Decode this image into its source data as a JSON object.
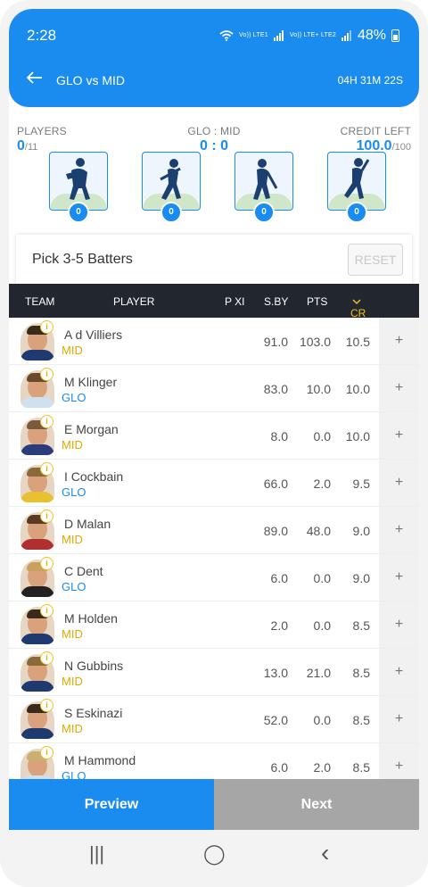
{
  "status_bar": {
    "time": "2:28",
    "signal_1": "Vo)) LTE1",
    "signal_2": "Vo)) LTE+ LTE2",
    "battery": "48%"
  },
  "header": {
    "back_icon": "arrow-left-icon",
    "title": "GLO vs MID",
    "timer": "04H 31M 22S"
  },
  "summary": {
    "players_label": "PLAYERS",
    "players_count": "0",
    "players_total": "/11",
    "match_label": "GLO : MID",
    "match_score": "0 : 0",
    "credit_label": "CREDIT LEFT",
    "credit_value": "100.0",
    "credit_total": "/100"
  },
  "roles": [
    {
      "icon": "wicket-keeper-icon",
      "count": "0"
    },
    {
      "icon": "batter-icon",
      "count": "0"
    },
    {
      "icon": "all-rounder-icon",
      "count": "0"
    },
    {
      "icon": "bowler-icon",
      "count": "0"
    }
  ],
  "pick": {
    "text": "Pick 3-5 Batters",
    "reset": "RESET"
  },
  "table": {
    "headers": {
      "team": "TEAM",
      "player": "PLAYER",
      "pxi": "P XI",
      "sby": "S.BY",
      "pts": "PTS",
      "cr": "CR"
    },
    "rows": [
      {
        "name": "A d Villiers",
        "team": "MID",
        "sby": "91.0",
        "pts": "103.0",
        "cr": "10.5"
      },
      {
        "name": "M Klinger",
        "team": "GLO",
        "sby": "83.0",
        "pts": "10.0",
        "cr": "10.0"
      },
      {
        "name": "E Morgan",
        "team": "MID",
        "sby": "8.0",
        "pts": "0.0",
        "cr": "10.0"
      },
      {
        "name": "I Cockbain",
        "team": "GLO",
        "sby": "66.0",
        "pts": "2.0",
        "cr": "9.5"
      },
      {
        "name": "D Malan",
        "team": "MID",
        "sby": "89.0",
        "pts": "48.0",
        "cr": "9.0"
      },
      {
        "name": "C Dent",
        "team": "GLO",
        "sby": "6.0",
        "pts": "0.0",
        "cr": "9.0"
      },
      {
        "name": "M Holden",
        "team": "MID",
        "sby": "2.0",
        "pts": "0.0",
        "cr": "8.5"
      },
      {
        "name": "N Gubbins",
        "team": "MID",
        "sby": "13.0",
        "pts": "21.0",
        "cr": "8.5"
      },
      {
        "name": "S Eskinazi",
        "team": "MID",
        "sby": "52.0",
        "pts": "0.0",
        "cr": "8.5"
      },
      {
        "name": "M Hammond",
        "team": "GLO",
        "sby": "6.0",
        "pts": "2.0",
        "cr": "8.5"
      }
    ],
    "add_symbol": "+",
    "info_symbol": "i"
  },
  "footer": {
    "preview": "Preview",
    "next": "Next"
  },
  "nav": {
    "recents": "|||",
    "home": "◯",
    "back": "‹"
  },
  "colors": {
    "primary": "#1a8cf0",
    "mid": "#e0a800",
    "glo": "#1a8cf0",
    "cr_accent": "#f0c020",
    "table_header": "#22262e"
  }
}
